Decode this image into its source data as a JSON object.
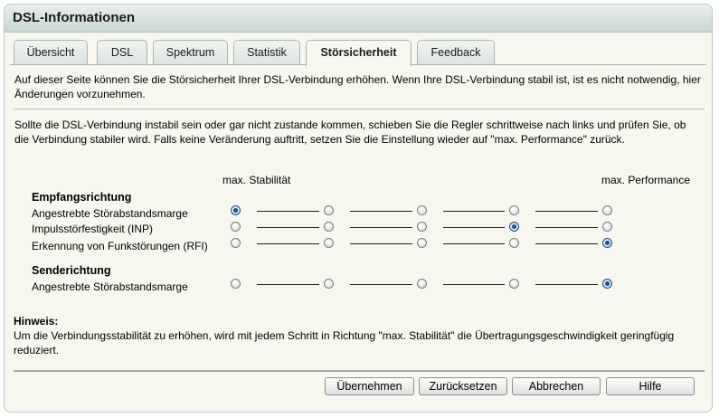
{
  "window": {
    "title": "DSL-Informationen"
  },
  "tabs": [
    {
      "label": "Übersicht",
      "active": false
    },
    {
      "label": "DSL",
      "active": false
    },
    {
      "label": "Spektrum",
      "active": false
    },
    {
      "label": "Statistik",
      "active": false
    },
    {
      "label": "Störsicherheit",
      "active": true
    },
    {
      "label": "Feedback",
      "active": false
    }
  ],
  "intro": "Auf dieser Seite können Sie die Störsicherheit Ihrer DSL-Verbindung erhöhen. Wenn Ihre DSL-Verbindung stabil ist, ist es nicht notwendig, hier Änderungen vorzunehmen.",
  "instructions": "Sollte die DSL-Verbindung instabil sein oder gar nicht zustande kommen, schieben Sie die Regler schrittweise nach links und prüfen Sie, ob die Verbindung stabiler wird. Falls keine Veränderung auftritt, setzen Sie die Einstellung wieder auf \"max. Performance\" zurück.",
  "scale": {
    "left_label": "max. Stabilität",
    "right_label": "max. Performance"
  },
  "receive": {
    "heading": "Empfangsrichtung",
    "rows": [
      {
        "label": "Angestrebte Störabstandsmarge",
        "selected_step": 1,
        "steps": 5
      },
      {
        "label": "Impulsstörfestigkeit (INP)",
        "selected_step": 4,
        "steps": 5
      },
      {
        "label": "Erkennung von Funkstörungen (RFI)",
        "selected_step": 5,
        "steps": 5
      }
    ]
  },
  "send": {
    "heading": "Senderichtung",
    "rows": [
      {
        "label": "Angestrebte Störabstandsmarge",
        "selected_step": 5,
        "steps": 5
      }
    ]
  },
  "hint": {
    "title": "Hinweis:",
    "text": "Um die Verbindungsstabilität zu erhöhen, wird mit jedem Schritt in Richtung \"max. Stabilität\" die Übertragungsgeschwindigkeit geringfügig reduziert."
  },
  "buttons": {
    "apply": "Übernehmen",
    "reset": "Zurücksetzen",
    "cancel": "Abbrechen",
    "help": "Hilfe"
  }
}
